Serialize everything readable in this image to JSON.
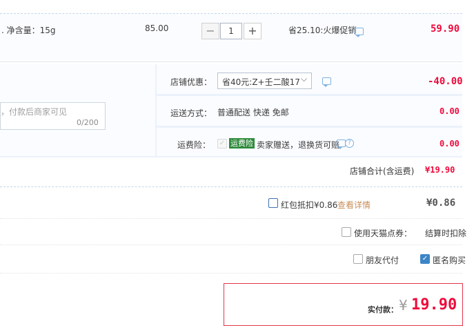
{
  "item": {
    "net_content": ". 净含量：15g",
    "unit_price": "85.00",
    "quantity": "1",
    "minus": "−",
    "plus": "+",
    "promo": "省25.10:火爆促销",
    "subtotal": "59.90"
  },
  "shop": {
    "discount_label": "店铺优惠：",
    "discount_select": "省40元:Z+壬二酸17",
    "discount_value": "-40.00",
    "memo_placeholder": "，付款后商家可见",
    "memo_counter": "0/200",
    "shipping_label": "运送方式：",
    "shipping_value": "普通配送 快递 免邮",
    "shipping_fee": "0.00",
    "insurance_label": "运费险：",
    "insurance_badge": "运费险",
    "insurance_desc": "卖家赠送，退换货可赔",
    "insurance_fee": "0.00",
    "total_label": "店铺合计(含运费)",
    "total_value": "¥19.90"
  },
  "redpacket": {
    "label": "红包抵扣¥0.86",
    "link": "查看详情",
    "value": "¥0.86"
  },
  "points": {
    "label": "使用天猫点券：",
    "note": "结算时扣除"
  },
  "options": {
    "friend_pay": "朋友代付",
    "anonymous": "匿名购买"
  },
  "payment": {
    "label": "实付款：",
    "currency": "¥",
    "amount": "19.90"
  },
  "colors": {
    "price_red": "#ee0a3b",
    "link_orange": "#c98d5a",
    "section_bg": "#eaf2fb",
    "badge_green": "#2e8a3b"
  }
}
